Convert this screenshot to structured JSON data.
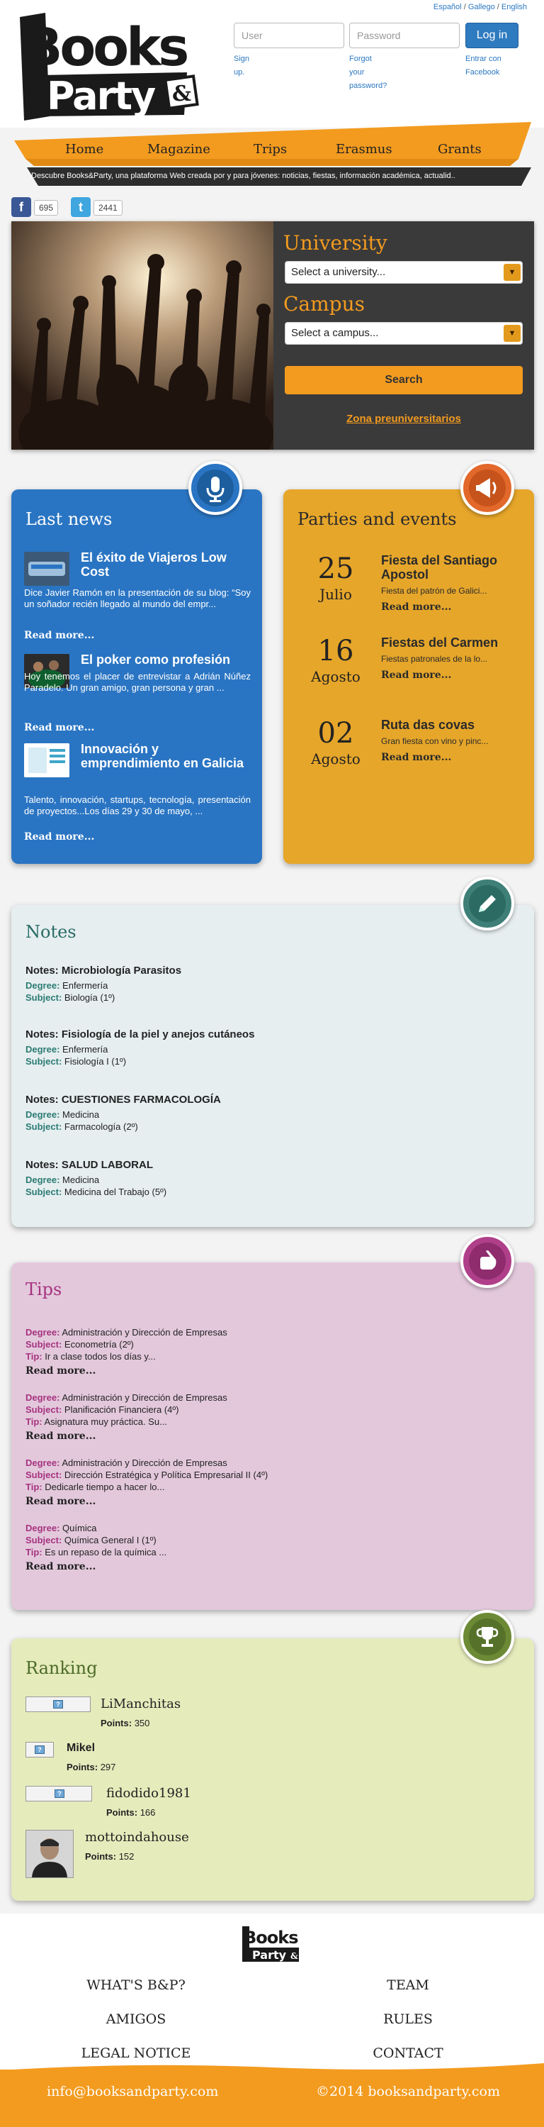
{
  "languages": [
    "Español",
    "Gallego",
    "English"
  ],
  "login": {
    "user_placeholder": "User",
    "password_placeholder": "Password",
    "button": "Log in",
    "signup": "Sign up.",
    "forgot": "Forgot your password?",
    "facebook": "Entrar con Facebook"
  },
  "logo_text": "Books & Party",
  "nav": {
    "items": [
      "Home",
      "Magazine",
      "Trips",
      "Erasmus",
      "Grants"
    ],
    "tagline": "Descubre Books&Party, una plataforma Web creada por y para jóvenes: noticias, fiestas, información académica, actualid.."
  },
  "social": {
    "facebook_icon": "f",
    "facebook_count": "695",
    "twitter_icon": "t",
    "twitter_count": "2441"
  },
  "hero": {
    "university_heading": "University",
    "university_select": "Select a university...",
    "campus_heading": "Campus",
    "campus_select": "Select a campus...",
    "search_button": "Search",
    "pre_link": "Zona preuniversitarios"
  },
  "news": {
    "title": "Last news",
    "items": [
      {
        "title": "El éxito de Viajeros Low Cost",
        "text": "Dice Javier Ramón en la presentación de su blog: “Soy un soñador recién llegado al mundo del empr...",
        "more": "Read more..."
      },
      {
        "title": "El poker como profesión",
        "text": "Hoy tenemos el placer de entrevistar a Adrián Núñez Paradelo. Un gran amigo, gran persona y gran ...",
        "more": "Read more..."
      },
      {
        "title": "Innovación y emprendimiento en Galicia",
        "text": "Talento, innovación, startups, tecnología, presentación de proyectos...Los días 29 y 30 de mayo, ...",
        "more": "Read more..."
      }
    ]
  },
  "parties": {
    "title": "Parties and events",
    "items": [
      {
        "day": "25",
        "month": "Julio",
        "name": "Fiesta del Santiago Apostol",
        "desc": "Fiesta del patrón de Galici...",
        "more": "Read more..."
      },
      {
        "day": "16",
        "month": "Agosto",
        "name": "Fiestas del Carmen",
        "desc": "Fiestas patronales de la lo...",
        "more": "Read more..."
      },
      {
        "day": "02",
        "month": "Agosto",
        "name": "Ruta das covas",
        "desc": "Gran fiesta con vino y pinc...",
        "more": "Read more..."
      }
    ]
  },
  "notes": {
    "title": "Notes",
    "degree_label": "Degree:",
    "subject_label": "Subject:",
    "items": [
      {
        "title": "Notes: Microbiología Parasitos",
        "degree": "Enfermería",
        "subject": "Biología (1º)"
      },
      {
        "title": "Notes: Fisiología de la piel y anejos cutáneos",
        "degree": "Enfermería",
        "subject": "Fisiología I (1º)"
      },
      {
        "title": "Notes: CUESTIONES FARMACOLOGÍA",
        "degree": "Medicina",
        "subject": "Farmacología (2º)"
      },
      {
        "title": "Notes: SALUD LABORAL",
        "degree": "Medicina",
        "subject": "Medicina del Trabajo (5º)"
      }
    ]
  },
  "tips": {
    "title": "Tips",
    "degree_label": "Degree:",
    "subject_label": "Subject:",
    "tip_label": "Tip:",
    "items": [
      {
        "degree": "Administración y Dirección de Empresas",
        "subject": "Econometría (2º)",
        "tip": "Ir a clase todos los días y...",
        "more": "Read more..."
      },
      {
        "degree": "Administración y Dirección de Empresas",
        "subject": "Planificación Financiera (4º)",
        "tip": "Asignatura muy práctica. Su...",
        "more": "Read more..."
      },
      {
        "degree": "Administración y Dirección de Empresas",
        "subject": "Dirección Estratégica y Política Empresarial II (4º)",
        "tip": "Dedicarle tiempo a hacer lo...",
        "more": "Read more..."
      },
      {
        "degree": "Química",
        "subject": "Química General I (1º)",
        "tip": "Es un repaso de la química ...",
        "more": "Read more..."
      }
    ]
  },
  "ranking": {
    "title": "Ranking",
    "points_label": "Points:",
    "items": [
      {
        "name": "LiManchitas",
        "points": "350"
      },
      {
        "name": "Mikel",
        "points": "297"
      },
      {
        "name": "fidodido1981",
        "points": "166"
      },
      {
        "name": "mottoindahouse",
        "points": "152"
      }
    ]
  },
  "footer": {
    "links": [
      "WHAT'S B&P?",
      "TEAM",
      "AMIGOS",
      "RULES",
      "LEGAL NOTICE",
      "CONTACT"
    ],
    "email": "info@booksandparty.com",
    "copyright": "©2014 booksandparty.com"
  },
  "colors": {
    "orange": "#f39b1f",
    "blue": "#2a75c3",
    "yellow": "#e6a62a",
    "notes_bg": "#e6eef0",
    "tips_bg": "#e3c8dc",
    "ranking_bg": "#e5ebbb"
  }
}
